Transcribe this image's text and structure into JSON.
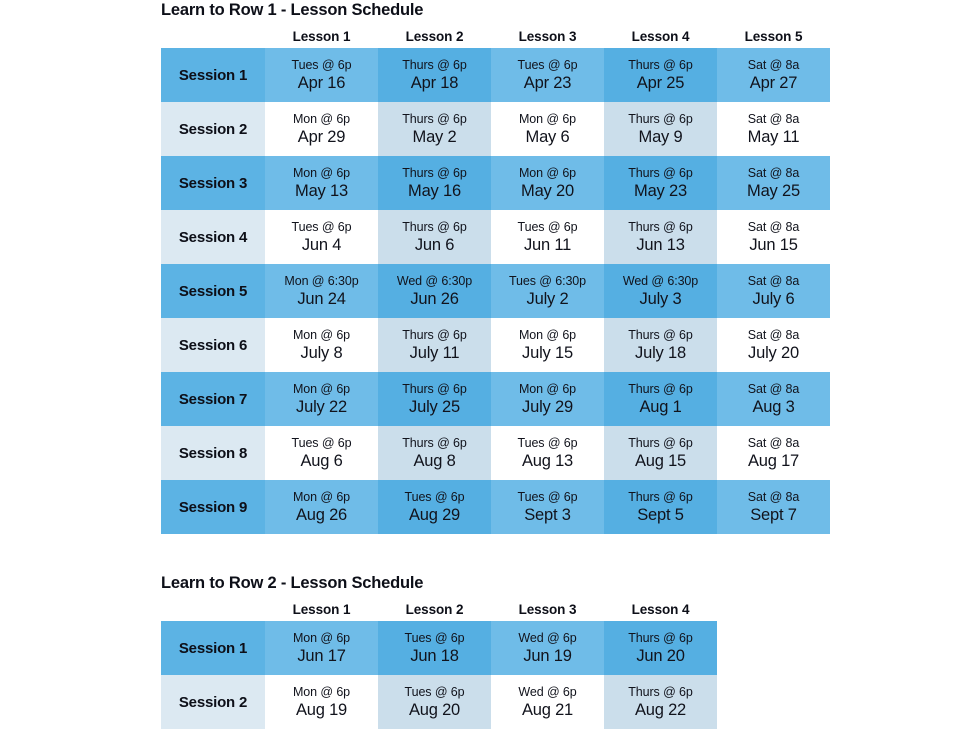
{
  "schedules": [
    {
      "title": "Learn to Row 1 - Lesson Schedule",
      "session_header": "",
      "lesson_headers": [
        "Lesson 1",
        "Lesson 2",
        "Lesson 3",
        "Lesson 4",
        "Lesson 5"
      ],
      "rows": [
        {
          "session": "Session 1",
          "shade": "blue",
          "cells": [
            {
              "time": "Tues @ 6p",
              "date": "Apr 16"
            },
            {
              "time": "Thurs @ 6p",
              "date": "Apr 18"
            },
            {
              "time": "Tues @ 6p",
              "date": "Apr 23"
            },
            {
              "time": "Thurs @ 6p",
              "date": "Apr 25"
            },
            {
              "time": "Sat @ 8a",
              "date": "Apr 27"
            }
          ]
        },
        {
          "session": "Session 2",
          "shade": "light",
          "cells": [
            {
              "time": "Mon @ 6p",
              "date": "Apr 29"
            },
            {
              "time": "Thurs @ 6p",
              "date": "May 2"
            },
            {
              "time": "Mon @ 6p",
              "date": "May 6"
            },
            {
              "time": "Thurs @ 6p",
              "date": "May 9"
            },
            {
              "time": "Sat @ 8a",
              "date": "May 11"
            }
          ]
        },
        {
          "session": "Session 3",
          "shade": "blue",
          "cells": [
            {
              "time": "Mon @ 6p",
              "date": "May 13"
            },
            {
              "time": "Thurs @ 6p",
              "date": "May 16"
            },
            {
              "time": "Mon @ 6p",
              "date": "May 20"
            },
            {
              "time": "Thurs @ 6p",
              "date": "May 23"
            },
            {
              "time": "Sat @ 8a",
              "date": "May 25"
            }
          ]
        },
        {
          "session": "Session 4",
          "shade": "light",
          "cells": [
            {
              "time": "Tues @ 6p",
              "date": "Jun 4"
            },
            {
              "time": "Thurs @ 6p",
              "date": "Jun 6"
            },
            {
              "time": "Tues @ 6p",
              "date": "Jun 11"
            },
            {
              "time": "Thurs @ 6p",
              "date": "Jun 13"
            },
            {
              "time": "Sat @ 8a",
              "date": "Jun 15"
            }
          ]
        },
        {
          "session": "Session 5",
          "shade": "blue",
          "cells": [
            {
              "time": "Mon @ 6:30p",
              "date": "Jun 24"
            },
            {
              "time": "Wed @ 6:30p",
              "date": "Jun 26"
            },
            {
              "time": "Tues @ 6:30p",
              "date": "July 2"
            },
            {
              "time": "Wed @ 6:30p",
              "date": "July 3"
            },
            {
              "time": "Sat @ 8a",
              "date": "July 6"
            }
          ]
        },
        {
          "session": "Session 6",
          "shade": "light",
          "cells": [
            {
              "time": "Mon @ 6p",
              "date": "July 8"
            },
            {
              "time": "Thurs @ 6p",
              "date": "July 11"
            },
            {
              "time": "Mon @ 6p",
              "date": "July 15"
            },
            {
              "time": "Thurs @ 6p",
              "date": "July 18"
            },
            {
              "time": "Sat @ 8a",
              "date": "July 20"
            }
          ]
        },
        {
          "session": "Session 7",
          "shade": "blue",
          "cells": [
            {
              "time": "Mon @ 6p",
              "date": "July 22"
            },
            {
              "time": "Thurs @ 6p",
              "date": "July 25"
            },
            {
              "time": "Mon @ 6p",
              "date": "July 29"
            },
            {
              "time": "Thurs @ 6p",
              "date": "Aug 1"
            },
            {
              "time": "Sat @ 8a",
              "date": "Aug 3"
            }
          ]
        },
        {
          "session": "Session 8",
          "shade": "light",
          "cells": [
            {
              "time": "Tues @ 6p",
              "date": "Aug 6"
            },
            {
              "time": "Thurs @ 6p",
              "date": "Aug 8"
            },
            {
              "time": "Tues @ 6p",
              "date": "Aug 13"
            },
            {
              "time": "Thurs @ 6p",
              "date": "Aug 15"
            },
            {
              "time": "Sat @ 8a",
              "date": "Aug 17"
            }
          ]
        },
        {
          "session": "Session 9",
          "shade": "blue",
          "cells": [
            {
              "time": "Mon @ 6p",
              "date": "Aug 26"
            },
            {
              "time": "Tues @ 6p",
              "date": "Aug 29"
            },
            {
              "time": "Tues @ 6p",
              "date": "Sept 3"
            },
            {
              "time": "Thurs @ 6p",
              "date": "Sept 5"
            },
            {
              "time": "Sat @ 8a",
              "date": "Sept 7"
            }
          ]
        }
      ]
    },
    {
      "title": "Learn to Row 2 - Lesson Schedule",
      "session_header": "",
      "lesson_headers": [
        "Lesson 1",
        "Lesson 2",
        "Lesson 3",
        "Lesson 4"
      ],
      "rows": [
        {
          "session": "Session 1",
          "shade": "blue",
          "cells": [
            {
              "time": "Mon @ 6p",
              "date": "Jun 17"
            },
            {
              "time": "Tues @ 6p",
              "date": "Jun 18"
            },
            {
              "time": "Wed @ 6p",
              "date": "Jun 19"
            },
            {
              "time": "Thurs @ 6p",
              "date": "Jun 20"
            }
          ]
        },
        {
          "session": "Session 2",
          "shade": "light",
          "cells": [
            {
              "time": "Mon @ 6p",
              "date": "Aug 19"
            },
            {
              "time": "Tues @ 6p",
              "date": "Aug 20"
            },
            {
              "time": "Wed @ 6p",
              "date": "Aug 21"
            },
            {
              "time": "Thurs @ 6p",
              "date": "Aug 22"
            }
          ]
        }
      ]
    }
  ],
  "colors": {
    "row_blue_session": "#5cb3e4",
    "row_blue_col_odd": "#6fbce8",
    "row_blue_col_even": "#55afe2",
    "row_light_session": "#dce9f2",
    "row_light_col_even": "#cbdeeb",
    "text": "#11131c"
  }
}
